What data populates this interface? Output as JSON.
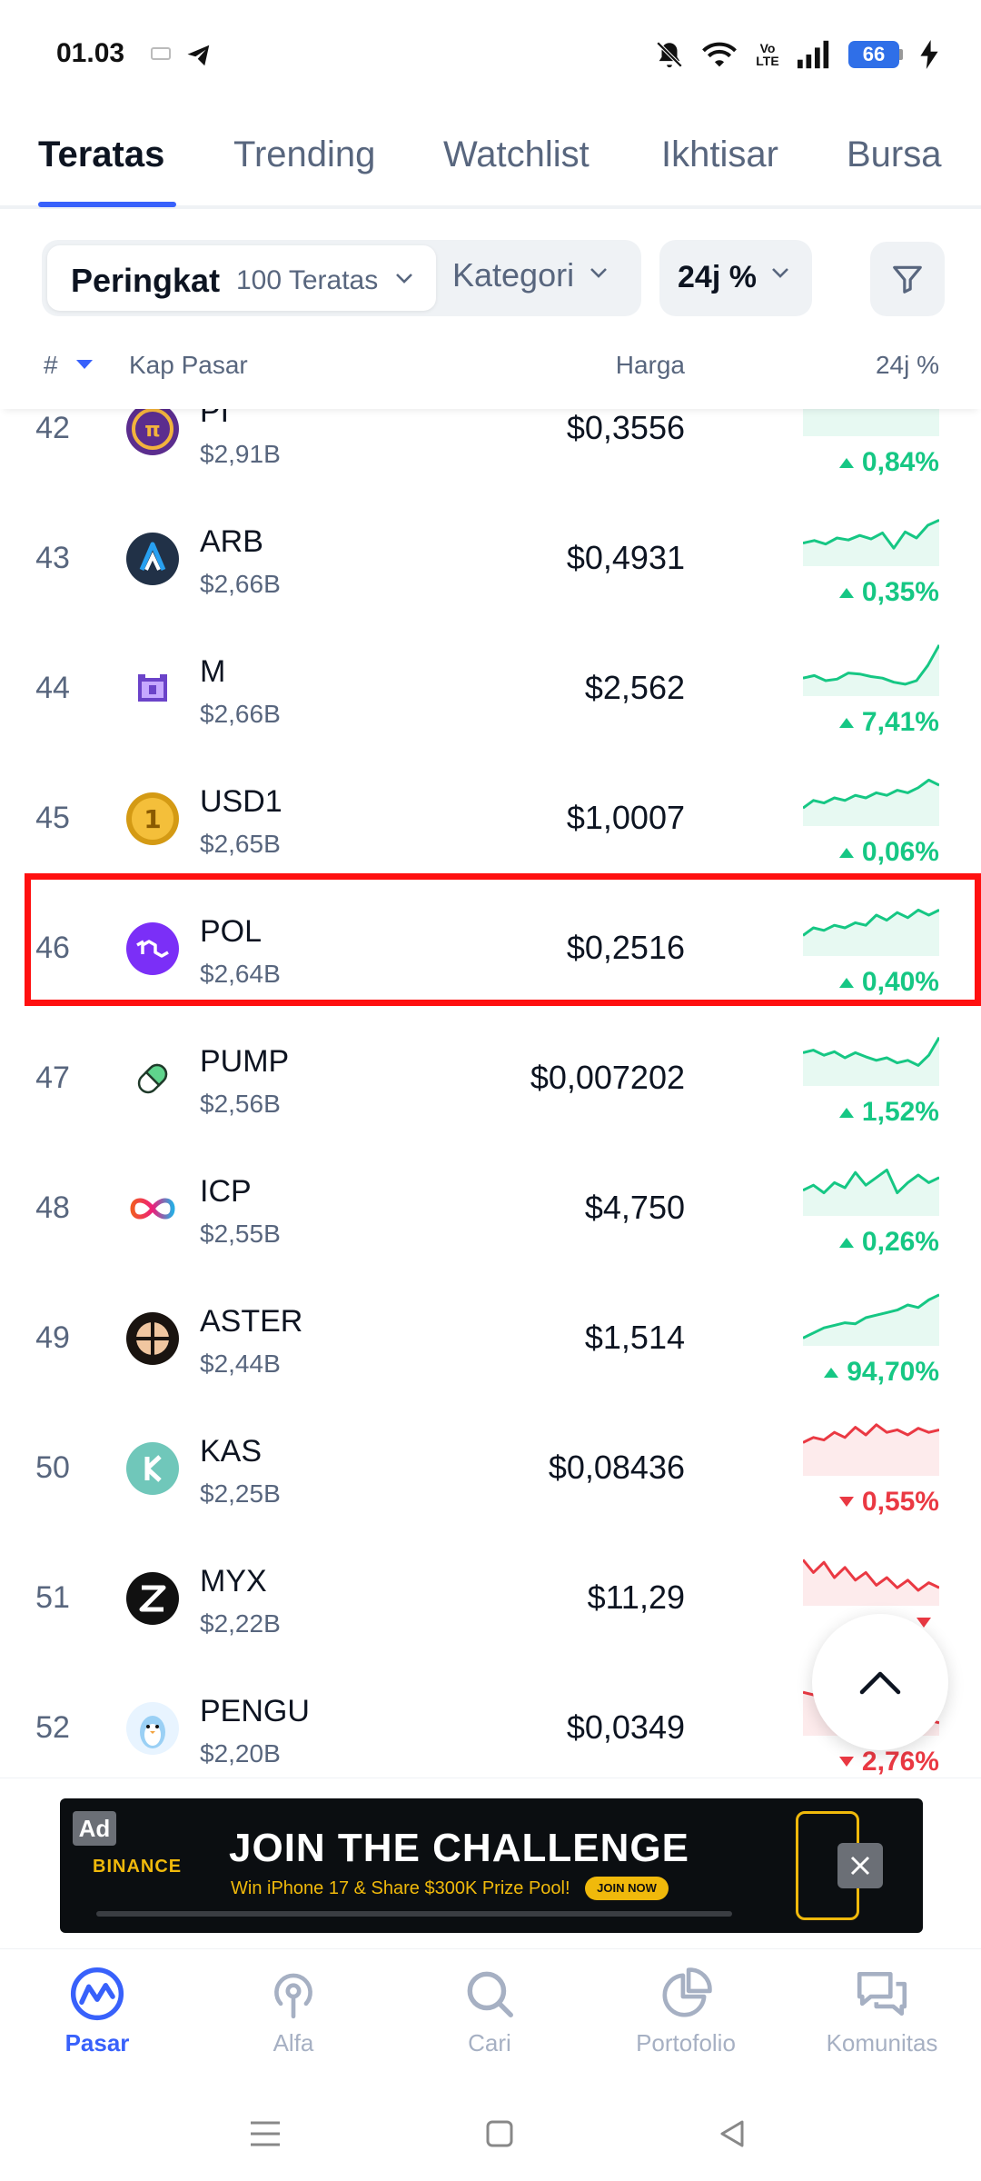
{
  "status_bar": {
    "time": "01.03",
    "network": "Vo LTE",
    "battery": "66"
  },
  "tabs": [
    {
      "label": "Teratas",
      "active": true
    },
    {
      "label": "Trending",
      "active": false
    },
    {
      "label": "Watchlist",
      "active": false
    },
    {
      "label": "Ikhtisar",
      "active": false
    },
    {
      "label": "Bursa",
      "active": false
    }
  ],
  "filters": {
    "rank_label": "Peringkat",
    "rank_value": "100 Teratas",
    "category_label": "Kategori",
    "change_label": "24j %"
  },
  "columns": {
    "rank": "#",
    "market_cap": "Kap Pasar",
    "price": "Harga",
    "change": "24j %"
  },
  "colors": {
    "accent": "#3861fb",
    "up": "#16c784",
    "down": "#ea3943",
    "highlight": "#ff1010"
  },
  "coins": [
    {
      "rank": "42",
      "symbol": "PI",
      "mcap": "$2,91B",
      "price": "$0,3556",
      "change": "0,84%",
      "direction": "up",
      "logo": "pi-logo",
      "spark": [
        0.55,
        0.7,
        0.6,
        0.8,
        0.75,
        0.9,
        0.85,
        0.8,
        0.95,
        0.9
      ]
    },
    {
      "rank": "43",
      "symbol": "ARB",
      "mcap": "$2,66B",
      "price": "$0,4931",
      "change": "0,35%",
      "direction": "up",
      "logo": "arb-logo",
      "spark": [
        0.4,
        0.45,
        0.38,
        0.5,
        0.46,
        0.55,
        0.48,
        0.6,
        0.3,
        0.62,
        0.5,
        0.75,
        0.85
      ]
    },
    {
      "rank": "44",
      "symbol": "M",
      "mcap": "$2,66B",
      "price": "$2,562",
      "change": "7,41%",
      "direction": "up",
      "logo": "m-logo",
      "spark": [
        0.3,
        0.35,
        0.25,
        0.28,
        0.4,
        0.38,
        0.33,
        0.3,
        0.22,
        0.18,
        0.25,
        0.55,
        0.95
      ]
    },
    {
      "rank": "45",
      "symbol": "USD1",
      "mcap": "$2,65B",
      "price": "$1,0007",
      "change": "0,06%",
      "direction": "up",
      "logo": "usd1-logo",
      "spark": [
        0.3,
        0.45,
        0.4,
        0.5,
        0.45,
        0.55,
        0.5,
        0.6,
        0.55,
        0.65,
        0.6,
        0.7,
        0.85,
        0.75
      ]
    },
    {
      "rank": "46",
      "symbol": "POL",
      "mcap": "$2,64B",
      "price": "$0,2516",
      "change": "0,40%",
      "direction": "up",
      "logo": "pol-logo",
      "spark": [
        0.35,
        0.5,
        0.45,
        0.55,
        0.5,
        0.6,
        0.55,
        0.75,
        0.65,
        0.8,
        0.7,
        0.85,
        0.75,
        0.85
      ]
    },
    {
      "rank": "47",
      "symbol": "PUMP",
      "mcap": "$2,56B",
      "price": "$0,007202",
      "change": "1,52%",
      "direction": "up",
      "logo": "pump-logo",
      "spark": [
        0.6,
        0.65,
        0.55,
        0.62,
        0.5,
        0.6,
        0.52,
        0.45,
        0.5,
        0.4,
        0.45,
        0.35,
        0.55,
        0.9
      ]
    },
    {
      "rank": "48",
      "symbol": "ICP",
      "mcap": "$2,55B",
      "price": "$4,750",
      "change": "0,26%",
      "direction": "up",
      "logo": "icp-logo",
      "spark": [
        0.45,
        0.55,
        0.4,
        0.6,
        0.5,
        0.8,
        0.55,
        0.7,
        0.85,
        0.4,
        0.6,
        0.75,
        0.6,
        0.7
      ]
    },
    {
      "rank": "49",
      "symbol": "ASTER",
      "mcap": "$2,44B",
      "price": "$1,514",
      "change": "94,70%",
      "direction": "up",
      "logo": "aster-logo",
      "spark": [
        0.1,
        0.2,
        0.3,
        0.35,
        0.4,
        0.38,
        0.5,
        0.55,
        0.6,
        0.65,
        0.75,
        0.7,
        0.85,
        0.95
      ]
    },
    {
      "rank": "50",
      "symbol": "KAS",
      "mcap": "$2,25B",
      "price": "$0,08436",
      "change": "0,55%",
      "direction": "down",
      "logo": "kas-logo",
      "spark": [
        0.6,
        0.7,
        0.65,
        0.8,
        0.7,
        0.9,
        0.75,
        0.95,
        0.8,
        0.85,
        0.75,
        0.88,
        0.8,
        0.85
      ]
    },
    {
      "rank": "51",
      "symbol": "MYX",
      "mcap": "$2,22B",
      "price": "$11,29",
      "change": "",
      "direction": "down",
      "logo": "myx-logo",
      "spark": [
        0.85,
        0.6,
        0.8,
        0.5,
        0.7,
        0.45,
        0.6,
        0.35,
        0.5,
        0.3,
        0.45,
        0.25,
        0.4,
        0.3
      ]
    },
    {
      "rank": "52",
      "symbol": "PENGU",
      "mcap": "$2,20B",
      "price": "$0,0349",
      "change": "2,76%",
      "direction": "down",
      "logo": "pengu-logo",
      "spark": [
        0.8,
        0.75,
        0.7,
        0.72,
        0.6,
        0.55,
        0.5,
        0.45,
        0.4,
        0.35,
        0.3,
        0.28,
        0.25,
        0.2
      ]
    }
  ],
  "ad": {
    "label": "Ad",
    "brand": "BINANCE",
    "headline": "JOIN THE  CHALLENGE",
    "subline": "Win iPhone 17 & Share $300K Prize Pool!",
    "cta": "JOIN NOW"
  },
  "bottom_nav": [
    {
      "label": "Pasar",
      "icon": "market-icon",
      "active": true
    },
    {
      "label": "Alfa",
      "icon": "alpha-icon",
      "active": false
    },
    {
      "label": "Cari",
      "icon": "search-icon",
      "active": false
    },
    {
      "label": "Portofolio",
      "icon": "portfolio-icon",
      "active": false
    },
    {
      "label": "Komunitas",
      "icon": "community-icon",
      "active": false
    }
  ]
}
